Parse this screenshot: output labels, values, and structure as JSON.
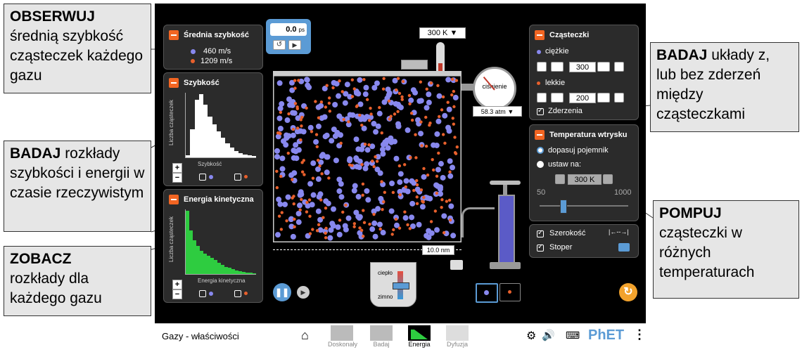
{
  "callouts": {
    "observe": {
      "title": "OBSERWUJ",
      "text": "średnią szybkość cząsteczek każdego gazu"
    },
    "explore_dist": {
      "title": "BADAJ",
      "text": "rozkłady szybkości i energii w czasie rzeczywistym"
    },
    "see": {
      "title": "ZOBACZ",
      "text": "rozkłady dla każdego gazu"
    },
    "explore_sys": {
      "title": "BADAJ",
      "text": "układy z, lub bez zderzeń między cząsteczkami"
    },
    "pump": {
      "title": "POMPUJ",
      "text": "cząsteczki w różnych temperaturach"
    }
  },
  "avg_speed": {
    "title": "Średnia szybkość",
    "heavy": "460 m/s",
    "light": "1209 m/s"
  },
  "speed_panel": {
    "title": "Szybkość",
    "ylabel": "Liczba cząsteczek",
    "xlabel": "Szybkość",
    "plus": "+",
    "minus": "−"
  },
  "energy_panel": {
    "title": "Energia kinetyczna",
    "ylabel": "Liczba cząsteczek",
    "xlabel": "Energia kinetyczna",
    "plus": "+",
    "minus": "−"
  },
  "stopwatch": {
    "value": "0.0",
    "unit": "ps"
  },
  "thermometer": {
    "value": "300 K"
  },
  "gauge": {
    "label": "ciśnienie",
    "value": "58.3 atm"
  },
  "width_readout": "10.0 nm",
  "heat_cool": {
    "heat": "ciepło",
    "cool": "zimno"
  },
  "particles": {
    "title": "Cząsteczki",
    "heavy_label": "ciężkie",
    "heavy_count": "300",
    "light_label": "lekkie",
    "light_count": "200",
    "collisions_label": "Zderzenia"
  },
  "injection": {
    "title": "Temperatura wtrysku",
    "opt1": "dopasuj pojemnik",
    "opt2": "ustaw na:",
    "temp": "300 K",
    "min": "50",
    "max": "1000",
    "slider_fraction": 0.263
  },
  "bottom_checks": {
    "width": "Szerokość",
    "stopwatch": "Stoper"
  },
  "nav": {
    "title": "Gazy - właściwości",
    "tabs": [
      "Doskonały",
      "Badaj",
      "Energia",
      "Dyfuzja"
    ],
    "active": "Energia",
    "brand": "PhET"
  },
  "colors": {
    "heavy": "#8888ee",
    "light": "#e8602c",
    "accent": "#f26522",
    "histogram_speed": "#ffffff",
    "histogram_energy": "#2ecc40"
  },
  "speed_hist": [
    3,
    40,
    82,
    90,
    75,
    58,
    47,
    37,
    28,
    20,
    14,
    9,
    6,
    4,
    3,
    2
  ],
  "energy_hist": [
    90,
    62,
    48,
    40,
    33,
    29,
    26,
    23,
    20,
    16,
    13,
    10,
    9,
    7,
    5,
    4,
    3,
    2,
    2,
    1
  ]
}
